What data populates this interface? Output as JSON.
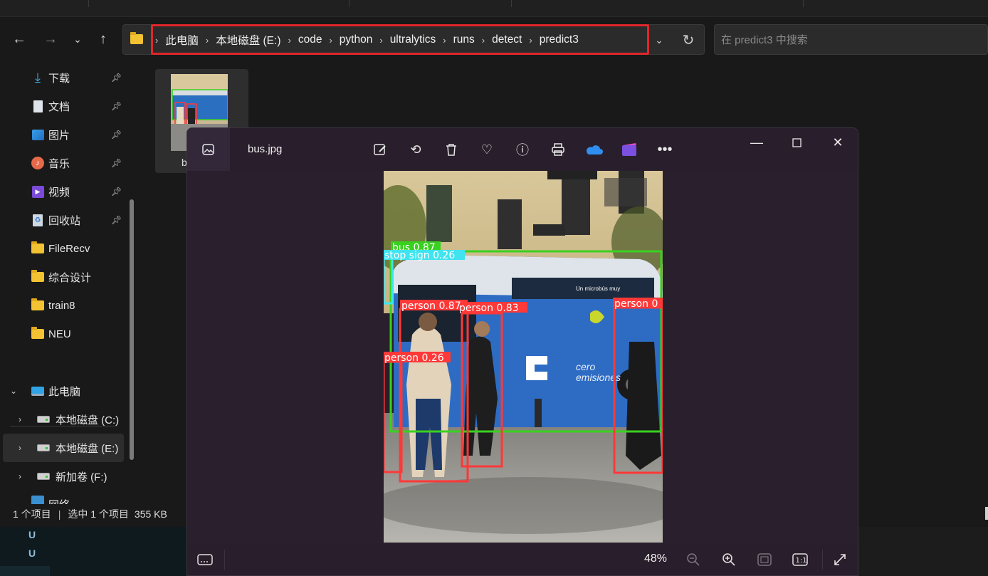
{
  "explorer": {
    "breadcrumbs": [
      "此电脑",
      "本地磁盘 (E:)",
      "code",
      "python",
      "ultralytics",
      "runs",
      "detect",
      "predict3"
    ],
    "search_placeholder": "在 predict3 中搜索",
    "sidebar": {
      "quick_access": [
        {
          "label": "下载",
          "icon": "download-icon"
        },
        {
          "label": "文档",
          "icon": "document-icon"
        },
        {
          "label": "图片",
          "icon": "pictures-icon"
        },
        {
          "label": "音乐",
          "icon": "music-icon"
        },
        {
          "label": "视频",
          "icon": "video-icon"
        },
        {
          "label": "回收站",
          "icon": "recycle-bin-icon"
        }
      ],
      "folders": [
        "FileRecv",
        "综合设计",
        "train8",
        "NEU"
      ],
      "this_pc": "此电脑",
      "drives": [
        "本地磁盘 (C:)",
        "本地磁盘 (E:)",
        "新加卷 (F:)"
      ],
      "network_partial": "网络"
    },
    "file_name_partial": "b",
    "status": {
      "count": "1 个项目",
      "selected": "选中 1 个项目",
      "size": "355 KB"
    }
  },
  "taskbar": {
    "letters": [
      "U",
      "U"
    ]
  },
  "photos": {
    "filename": "bus.jpg",
    "zoom": "48%",
    "detections": [
      {
        "label": "bus",
        "score": "0.87",
        "color": "#39d11f"
      },
      {
        "label": "stop sign",
        "score": "0.26",
        "color": "#3fe4f0"
      },
      {
        "label": "person",
        "score": "0.87",
        "color": "#ff3838"
      },
      {
        "label": "person",
        "score": "0.83",
        "color": "#ff3838"
      },
      {
        "label": "person",
        "score": "0",
        "color": "#ff3838"
      },
      {
        "label": "person",
        "score": "0.26",
        "color": "#ff3838"
      }
    ]
  },
  "colors": {
    "highlight": "#e0262b",
    "detection_person": "#ff3838",
    "detection_bus": "#39d11f",
    "detection_stop_sign": "#3fe4f0"
  }
}
